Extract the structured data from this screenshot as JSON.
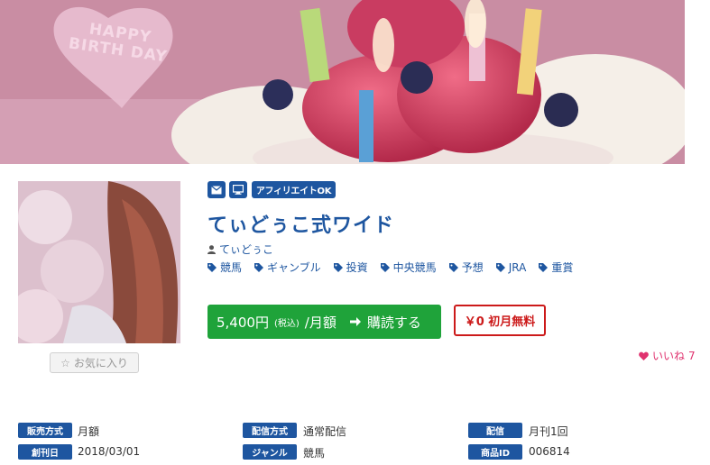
{
  "banner": {
    "cake_text": "HAPPY BIRTH DAY"
  },
  "badges": {
    "affiliate": "アフィリエイトOK",
    "icons": [
      "mail-icon",
      "monitor-icon"
    ]
  },
  "product": {
    "title": "てぃどぅこ式ワイド",
    "author": "てぃどぅこ",
    "tags": [
      "競馬",
      "ギャンブル",
      "投資",
      "中央競馬",
      "予想",
      "JRA",
      "重賞"
    ]
  },
  "purchase": {
    "price": "5,400円",
    "tax_note": "(税込)",
    "period": "/月額",
    "action": "購読する",
    "free_label": "￥0 初月無料"
  },
  "favorite": {
    "label": "お気に入り"
  },
  "likes": {
    "label": "いいね",
    "count": "7"
  },
  "info": {
    "sales_method": {
      "label": "販売方式",
      "value": "月額"
    },
    "delivery_method": {
      "label": "配信方式",
      "value": "通常配信"
    },
    "delivery": {
      "label": "配信",
      "value": "月刊1回"
    },
    "launch_date": {
      "label": "創刊日",
      "value": "2018/03/01"
    },
    "genre": {
      "label": "ジャンル",
      "value": "競馬"
    },
    "product_id": {
      "label": "商品ID",
      "value": "006814"
    }
  },
  "colors": {
    "brand": "#1e56a0",
    "buy": "#1fa33a",
    "free": "#cc1a1a",
    "like": "#e0336f"
  }
}
